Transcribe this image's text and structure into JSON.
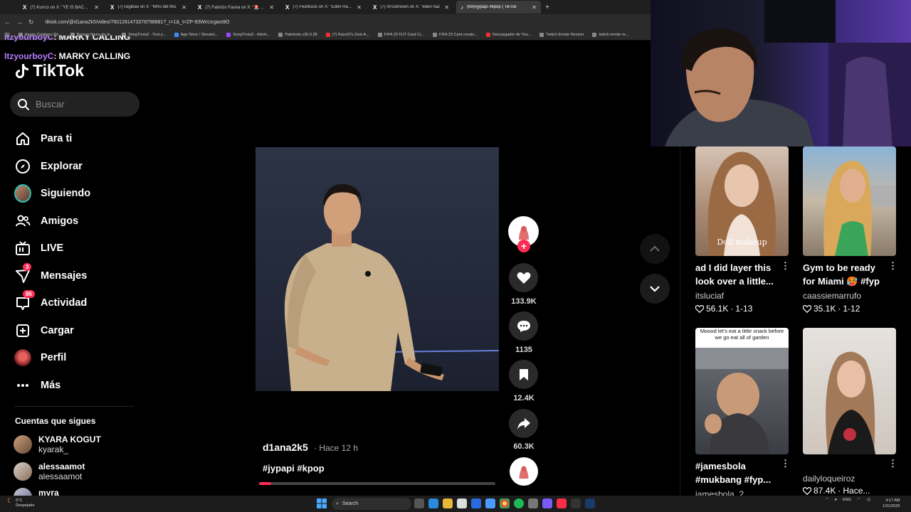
{
  "browser": {
    "tabs": [
      {
        "title": "(7) Kurrco on X: \"YE IS BACK 🧎",
        "active": false
      },
      {
        "title": "(7) Gigibae on X: \"Who did this",
        "active": false
      },
      {
        "title": "(7) Fabrizio Fauna on X: \"🚨 BR",
        "active": false
      },
      {
        "title": "(7) FearBuck on X: \"Eden Hazar",
        "active": false
      },
      {
        "title": "(7) mr1xknown on X: \"eden haz",
        "active": false
      },
      {
        "title": "(69)#jypapi #kpop | TikTok",
        "active": true
      }
    ],
    "url": "tiktok.com/@d1ana2k5/video/7601281473378798881?_r=1&_t=ZP-93WnUcgwo9O",
    "bookmarks": [
      "Happy Cristiano Ro...",
      "Burago figura de to...",
      "SongTrivia2 - Test y...",
      "App Store / Streami...",
      "SongTrivia2 - Advin...",
      "Paletools v26.0.28",
      "(7) Razo97s Zest-A...",
      "FIFA 23 FUT Card Cr...",
      "FIFA 23 Card creato...",
      "Descargador de You...",
      "Twitch Emote Resizer",
      "twitch emote re..."
    ]
  },
  "chat": [
    {
      "user": "ItzyourboyC",
      "text": ": MARKY CALLING"
    },
    {
      "user": "ItzyourboyC",
      "text": ": MARKY CALLING"
    }
  ],
  "sidebar": {
    "logo": "TikTok",
    "search_placeholder": "Buscar",
    "menu": [
      {
        "label": "Para ti",
        "icon": "home-icon",
        "badge": ""
      },
      {
        "label": "Explorar",
        "icon": "compass-icon",
        "badge": ""
      },
      {
        "label": "Siguiendo",
        "icon": "following-avatar",
        "badge": ""
      },
      {
        "label": "Amigos",
        "icon": "friends-icon",
        "badge": ""
      },
      {
        "label": "LIVE",
        "icon": "live-icon",
        "badge": ""
      },
      {
        "label": "Mensajes",
        "icon": "messages-icon",
        "badge": "3"
      },
      {
        "label": "Actividad",
        "icon": "activity-icon",
        "badge": "86"
      },
      {
        "label": "Cargar",
        "icon": "upload-icon",
        "badge": ""
      },
      {
        "label": "Perfil",
        "icon": "profile-avatar",
        "badge": ""
      },
      {
        "label": "Más",
        "icon": "more-icon",
        "badge": ""
      }
    ],
    "following_title": "Cuentas que sigues",
    "following": [
      {
        "name": "KYARA KOGUT",
        "handle": "kyarak_"
      },
      {
        "name": "alessaamot",
        "handle": "alessaamot"
      },
      {
        "name": "myra",
        "handle": ""
      }
    ]
  },
  "video": {
    "author": "d1ana2k5",
    "time": "· Hace 12 h",
    "description": "#jypapi #kpop",
    "likes": "133.9K",
    "comments": "1135",
    "saves": "12.4K",
    "shares": "60.3K",
    "progress": 0.05
  },
  "related": [
    {
      "title": "ad I did layer this look over a little...",
      "author": "itsluciaf",
      "likes": "56.1K",
      "date": "1-13",
      "caption": "Doll makeup"
    },
    {
      "title": "Gym to be ready for Miami 🥵 #fyp",
      "author": "caassiemarrufo",
      "likes": "35.1K",
      "date": "1-12",
      "caption": ""
    },
    {
      "title": "#jamesbola #mukbang #fyp...",
      "author": "jamesbola_2",
      "likes": "",
      "date": "",
      "caption": "Moood let's eat a little snack before we go eat all of garden"
    },
    {
      "title": "dailyloqueiroz",
      "author": "",
      "likes": "87.4K",
      "date": "Hace...",
      "caption": ""
    }
  ],
  "taskbar": {
    "weather_temp": "6°C",
    "weather_text": "Despejado",
    "search": "Search",
    "lang": "ENG",
    "time": "4:17 AM",
    "date": "1/31/2026"
  }
}
